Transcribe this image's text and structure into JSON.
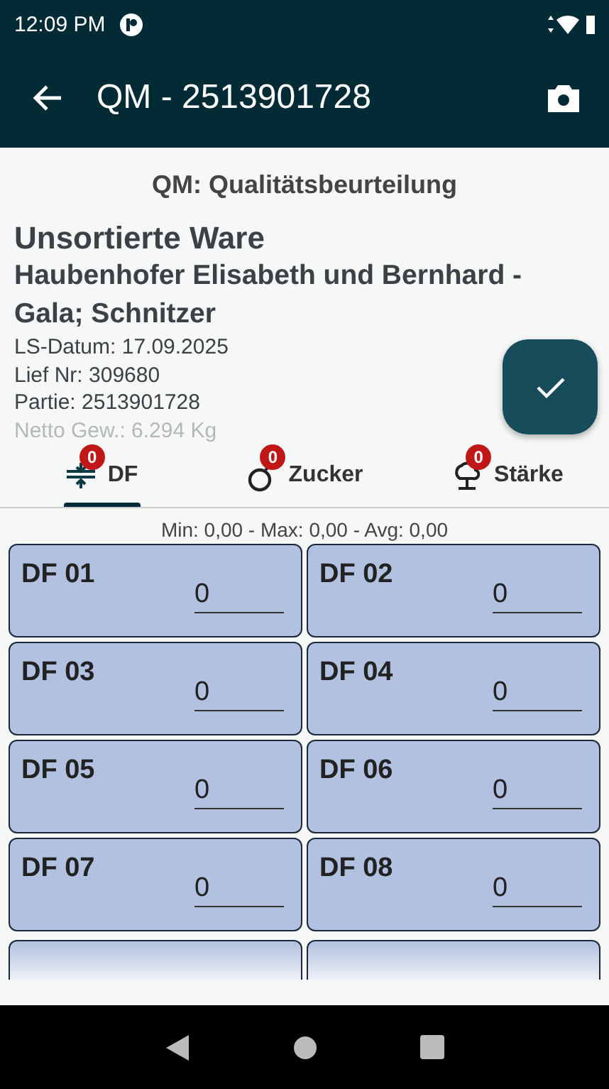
{
  "status_bar": {
    "time": "12:09 PM"
  },
  "app_bar": {
    "title": "QM - 2513901728"
  },
  "heading": "QM: Qualitätsbeurteilung",
  "details": {
    "title": "Unsortierte Ware",
    "subtitle": "Haubenhofer Elisabeth und Bernhard - Gala; Schnitzer",
    "lines": [
      "LS-Datum: 17.09.2025",
      "Lief Nr: 309680",
      "Partie: 2513901728",
      "Netto Gew.: 6.294 Kg"
    ]
  },
  "tabs": [
    {
      "kind": "df",
      "label": "DF",
      "badge": "0",
      "selected": true
    },
    {
      "kind": "sugar",
      "label": "Zucker",
      "badge": "0",
      "selected": false
    },
    {
      "kind": "starch",
      "label": "Stärke",
      "badge": "0",
      "selected": false
    }
  ],
  "stats": "Min: 0,00 - Max: 0,00 - Avg: 0,00",
  "cards": [
    {
      "label": "DF 01",
      "value": "0"
    },
    {
      "label": "DF 02",
      "value": "0"
    },
    {
      "label": "DF 03",
      "value": "0"
    },
    {
      "label": "DF 04",
      "value": "0"
    },
    {
      "label": "DF 05",
      "value": "0"
    },
    {
      "label": "DF 06",
      "value": "0"
    },
    {
      "label": "DF 07",
      "value": "0"
    },
    {
      "label": "DF 08",
      "value": "0"
    }
  ]
}
